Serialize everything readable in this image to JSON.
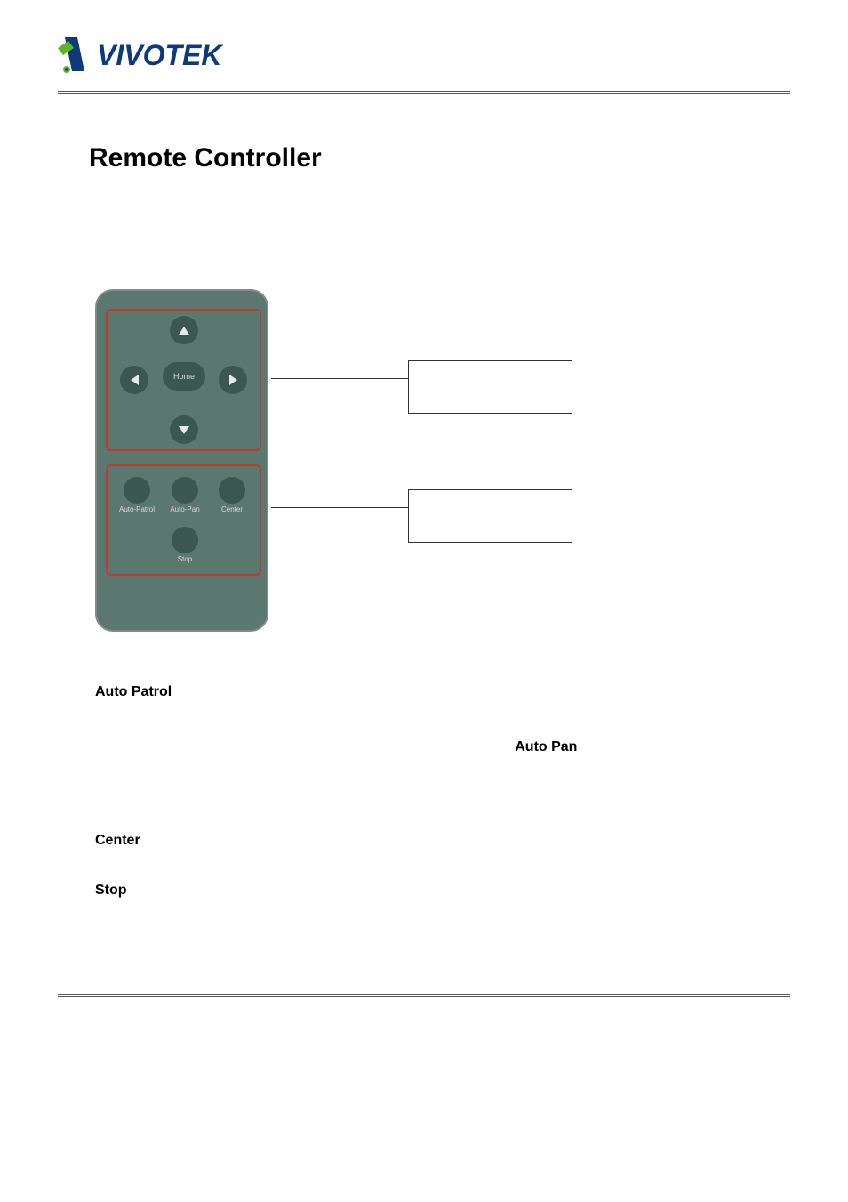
{
  "brand": "VIVOTEK",
  "section_title": "Remote Controller",
  "remote": {
    "home_label": "Home",
    "func_labels": {
      "auto_patrol": "Auto-Patrol",
      "auto_pan": "Auto-Pan",
      "center": "Center",
      "stop": "Stop"
    }
  },
  "terms": {
    "auto_patrol": "Auto Patrol",
    "auto_pan": "Auto Pan",
    "center": "Center",
    "stop": "Stop"
  }
}
